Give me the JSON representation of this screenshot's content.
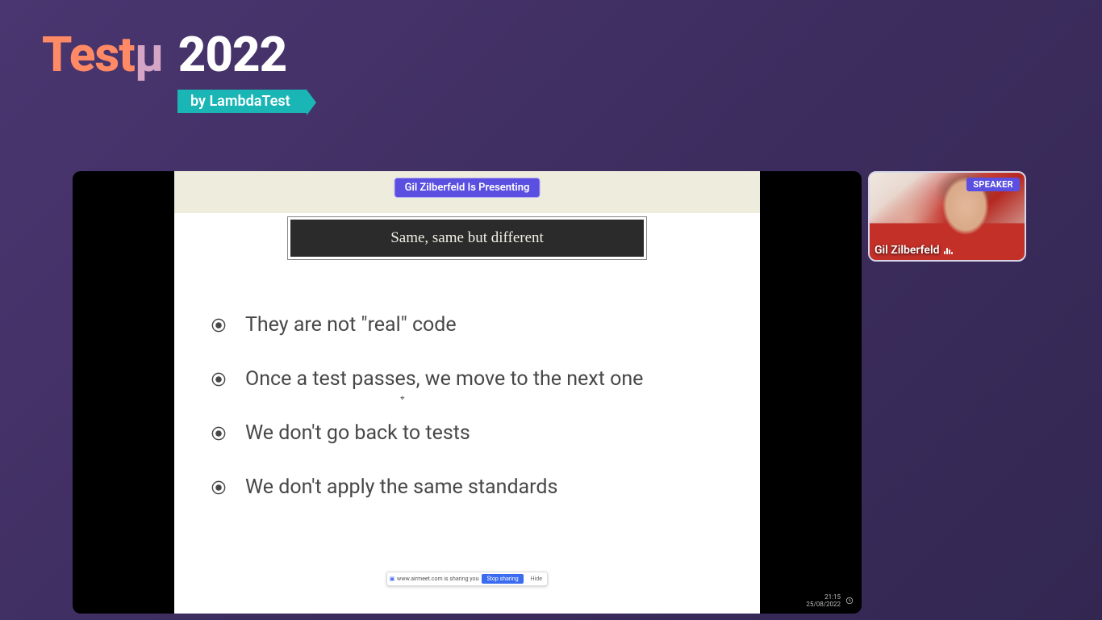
{
  "logo": {
    "brand_part1": "Test",
    "brand_part2": "μ",
    "year": "2022",
    "byline": "by LambdaTest"
  },
  "presenting_pill": "Gil Zilberfeld Is Presenting",
  "slide": {
    "title": "Same, same but different",
    "bullets": [
      "They are not \"real\" code",
      "Once a test passes, we move to the next one",
      "We don't go back to tests",
      "We don't apply the same standards"
    ]
  },
  "share_bar": {
    "message": "www.airmeet.com is sharing your screen.",
    "stop": "Stop sharing",
    "hide": "Hide"
  },
  "stage_footer": {
    "time": "21:15",
    "date": "25/08/2022"
  },
  "speaker": {
    "badge": "SPEAKER",
    "name": "Gil Zilberfeld"
  }
}
